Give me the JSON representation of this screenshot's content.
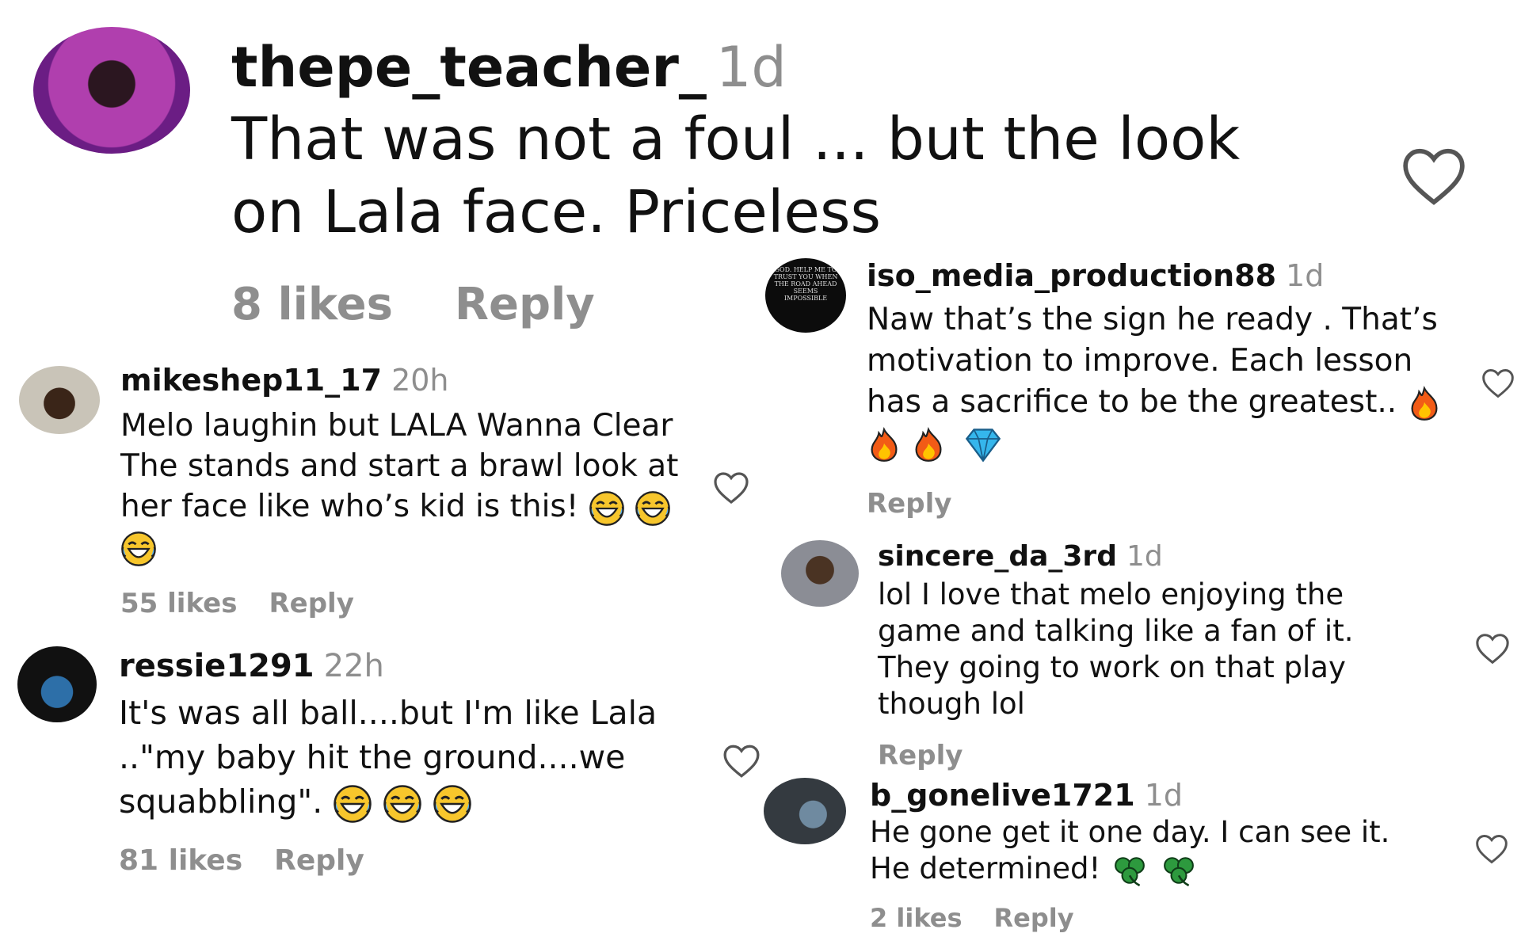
{
  "main": {
    "username": "thepe_teacher_",
    "time": "1d",
    "text_line1": "That was not a foul ... but the look",
    "text_line2": "on Lala face. Priceless",
    "likes": "8 likes",
    "reply": "Reply"
  },
  "c1": {
    "username": "mikeshep11_17",
    "time": "20h",
    "text": "Melo laughin but LALA Wanna Clear The stands and start a brawl look at her face like who’s kid is this!",
    "likes": "55 likes",
    "reply": "Reply"
  },
  "c2": {
    "username": "ressie1291",
    "time": "22h",
    "text_line1": "It's was all ball....but I'm like Lala",
    "text_line2": "..\"my baby hit the ground....we",
    "text_line3": "squabbling\".",
    "likes": "81 likes",
    "reply": "Reply"
  },
  "c3": {
    "username": "iso_media_production88",
    "time": "1d",
    "text": "Naw that’s the sign he ready . That’s motivation to improve. Each lesson has a sacrifice to be the greatest..",
    "reply": "Reply",
    "avatar_text": "GOD. HELP ME TO TRUST YOU WHEN THE ROAD AHEAD SEEMS IMPOSSIBLE"
  },
  "c4": {
    "username": "sincere_da_3rd",
    "time": "1d",
    "text": "lol I love that melo enjoying the game and talking like a fan of it. They going to work on that play though lol",
    "reply": "Reply"
  },
  "c5": {
    "username": "b_gonelive1721",
    "time": "1d",
    "text_line1": "He gone get it one day. I can see it.",
    "text_line2": "He determined!",
    "likes": "2 likes",
    "reply": "Reply"
  },
  "icons": {
    "heart": "heart-outline-icon",
    "laugh": "tears-of-joy-emoji",
    "fire": "fire-emoji",
    "gem": "gem-emoji",
    "clover": "shamrock-emoji"
  },
  "colors": {
    "meta_gray": "#8e8e8e",
    "heart_outline": "#555555"
  }
}
